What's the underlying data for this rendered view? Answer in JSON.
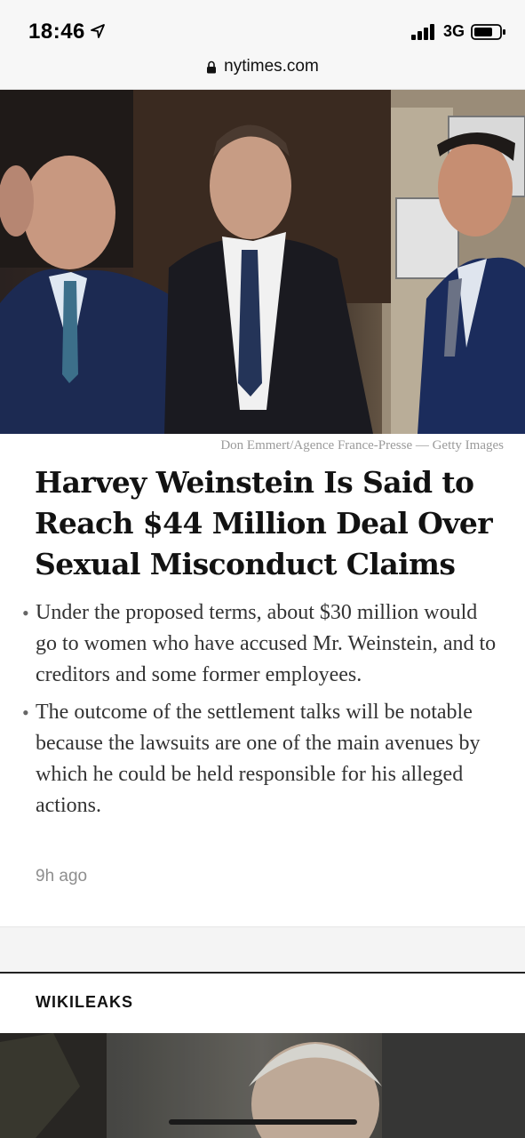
{
  "status_bar": {
    "time": "18:46",
    "network": "3G",
    "location_icon": "location-arrow-icon",
    "signal_icon": "signal-bars-icon",
    "battery_icon": "battery-icon"
  },
  "browser": {
    "url": "nytimes.com",
    "lock_icon": "lock-icon"
  },
  "article": {
    "photo_credit": "Don Emmert/Agence France-Presse — Getty Images",
    "headline": "Harvey Weinstein Is Said to Reach $44 Million Deal Over Sexual Misconduct Claims",
    "summary": [
      "Under the proposed terms, about $30 million would go to women who have accused Mr. Weinstein, and to creditors and some former employees.",
      "The outcome of the settlement talks will be notable because the lawsuits are one of the main avenues by which he could be held responsible for his alleged actions."
    ],
    "timestamp": "9h ago"
  },
  "next_section": {
    "label": "WIKILEAKS"
  },
  "colors": {
    "headline": "#121212",
    "body": "#333333",
    "muted": "#8e8e8e",
    "status_bg": "#f7f7f7"
  }
}
